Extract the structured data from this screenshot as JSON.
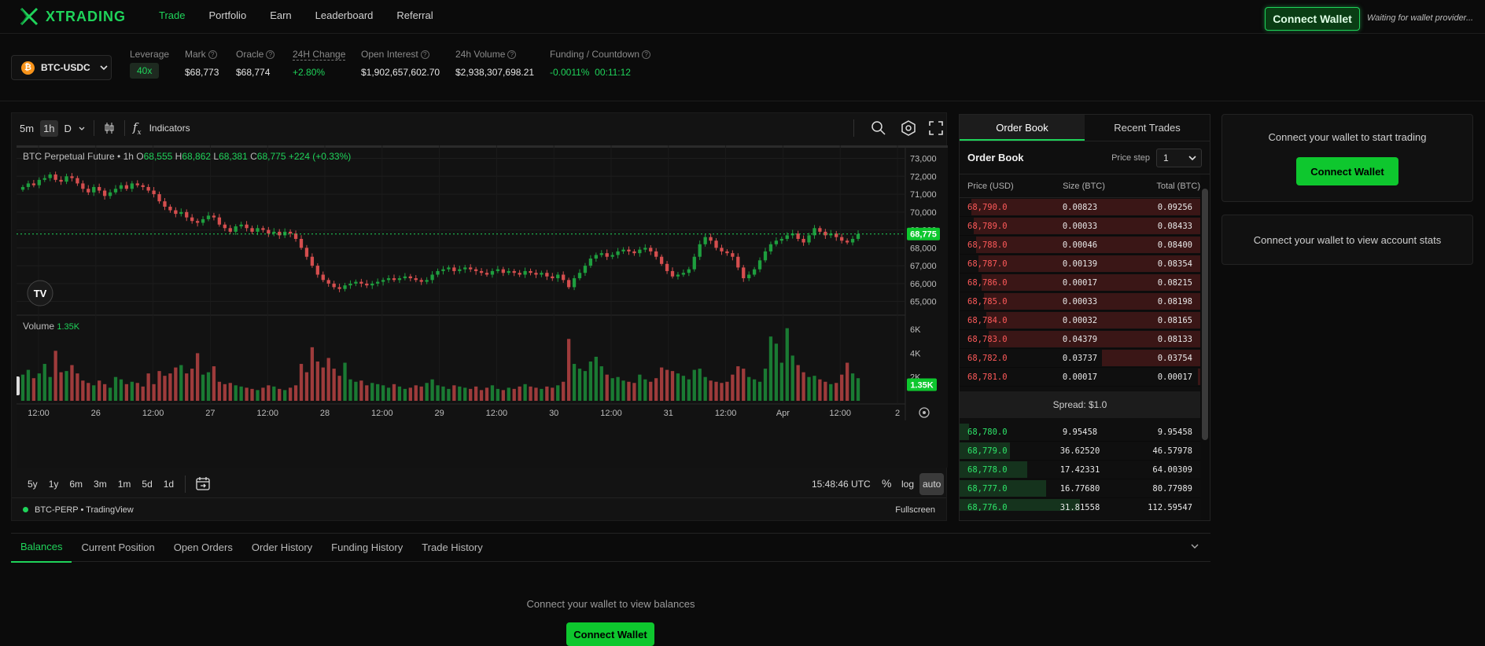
{
  "brand": {
    "name": "XTRADING",
    "color": "#1fd35a"
  },
  "nav": {
    "items": [
      "Trade",
      "Portfolio",
      "Earn",
      "Leaderboard",
      "Referral"
    ],
    "active": "Trade"
  },
  "header": {
    "connect_label": "Connect Wallet",
    "status": "Waiting for wallet provider..."
  },
  "market": {
    "symbol": "BTC-USDC",
    "stats": {
      "leverage_label": "Leverage",
      "leverage": "40x",
      "mark_label": "Mark",
      "mark": "$68,773",
      "oracle_label": "Oracle",
      "oracle": "$68,774",
      "change_label": "24H Change",
      "change": "+2.80%",
      "oi_label": "Open Interest",
      "oi": "$1,902,657,602.70",
      "vol_label": "24h Volume",
      "vol": "$2,938,307,698.21",
      "funding_label": "Funding / Countdown",
      "funding": "-0.0011%",
      "countdown": "00:11:12"
    }
  },
  "chart_toolbar": {
    "timeframes": [
      "5m",
      "1h",
      "D"
    ],
    "active_tf": "1h",
    "indicators": "Indicators"
  },
  "chart_data": {
    "type": "candlestick",
    "title": "BTC Perpetual Future",
    "interval": "1h",
    "ohlc": {
      "o": "68,555",
      "h": "68,862",
      "l": "68,381",
      "c": "68,775",
      "chg": "+224 (+0.33%)"
    },
    "last_price": "68,775",
    "y_ticks": [
      "73,000",
      "72,000",
      "71,000",
      "70,000",
      "69,000",
      "68,000",
      "67,000",
      "66,000",
      "65,000"
    ],
    "ylim": [
      64500,
      73200
    ],
    "x_ticks": [
      "12:00",
      "26",
      "12:00",
      "27",
      "12:00",
      "28",
      "12:00",
      "29",
      "12:00",
      "30",
      "12:00",
      "31",
      "12:00",
      "Apr",
      "12:00",
      "2"
    ],
    "volume_label": "Volume",
    "volume_value": "1.35K",
    "volume_ticks": [
      "6K",
      "4K",
      "2K"
    ],
    "volume_ylim": [
      0,
      6800
    ],
    "closes": [
      71400,
      71600,
      71500,
      71800,
      71900,
      72100,
      71800,
      71700,
      72000,
      71900,
      71600,
      71300,
      71100,
      71400,
      71200,
      70900,
      71100,
      71300,
      71500,
      71300,
      71600,
      71500,
      71400,
      71200,
      71000,
      70600,
      70300,
      70100,
      69900,
      70000,
      69700,
      69500,
      69400,
      69600,
      69800,
      69700,
      69300,
      69100,
      68900,
      69200,
      69300,
      69100,
      68900,
      69100,
      69000,
      68800,
      68900,
      68700,
      68900,
      68800,
      68500,
      68000,
      67500,
      67000,
      66500,
      66200,
      66000,
      65800,
      65700,
      65900,
      66000,
      66100,
      66000,
      65900,
      66000,
      66100,
      66200,
      66300,
      66200,
      66300,
      66400,
      66300,
      66200,
      66100,
      66200,
      66500,
      66700,
      66800,
      66900,
      66700,
      66800,
      66900,
      66800,
      66700,
      66600,
      66500,
      66700,
      66800,
      66600,
      66700,
      66600,
      66500,
      66700,
      66600,
      66500,
      66600,
      66400,
      66300,
      66500,
      66200,
      65800,
      66300,
      66600,
      67000,
      67400,
      67600,
      67700,
      67500,
      67600,
      67800,
      67900,
      67800,
      67700,
      67900,
      68000,
      67800,
      67500,
      67100,
      66700,
      66400,
      66500,
      66600,
      66800,
      67500,
      68200,
      68600,
      68400,
      68000,
      67800,
      67700,
      67500,
      66900,
      66300,
      66500,
      66800,
      67300,
      67800,
      68200,
      68400,
      68500,
      68700,
      68800,
      68500,
      68300,
      68700,
      69100,
      68900,
      68700,
      68800,
      68600,
      68400,
      68300,
      68500,
      68775
    ],
    "volumes": [
      2200,
      2600,
      1900,
      2300,
      3100,
      2000,
      4200,
      2400,
      2500,
      3000,
      2300,
      1700,
      1500,
      1300,
      1700,
      1400,
      1100,
      2000,
      1800,
      1400,
      1600,
      1500,
      1200,
      2300,
      1400,
      2500,
      2100,
      2300,
      2800,
      3000,
      2300,
      2700,
      4000,
      2200,
      2400,
      2900,
      1600,
      1400,
      1500,
      1300,
      1200,
      1100,
      1000,
      900,
      1100,
      1300,
      1200,
      1000,
      900,
      1100,
      1300,
      3100,
      2400,
      4500,
      3300,
      2800,
      3600,
      2700,
      2100,
      3200,
      1800,
      1600,
      1700,
      1300,
      1500,
      1400,
      1300,
      1100,
      1400,
      1200,
      1000,
      1100,
      1300,
      1200,
      1500,
      1800,
      1300,
      1200,
      1000,
      1300,
      1200,
      1100,
      1000,
      1200,
      900,
      1100,
      1300,
      1000,
      900,
      1100,
      1000,
      1200,
      1400,
      1200,
      1100,
      1000,
      1200,
      1100,
      1300,
      1600,
      5200,
      3100,
      2700,
      2500,
      3300,
      3700,
      2900,
      2200,
      1900,
      2000,
      1700,
      1600,
      1500,
      2200,
      1800,
      1600,
      1900,
      2800,
      2600,
      2500,
      2300,
      2100,
      1800,
      2600,
      2700,
      2000,
      1700,
      1600,
      1500,
      1600,
      2200,
      2900,
      2700,
      2000,
      1800,
      1600,
      2700,
      5400,
      4800,
      3200,
      6100,
      3800,
      3000,
      2400,
      2000,
      2100,
      1800,
      1600,
      1400,
      1500,
      2200,
      3200,
      2300,
      1900,
      1700,
      2100,
      1500,
      1400,
      3100,
      2200,
      1350
    ]
  },
  "chart_footer": {
    "ranges": [
      "5y",
      "1y",
      "6m",
      "3m",
      "1m",
      "5d",
      "1d"
    ],
    "time": "15:48:46 UTC",
    "pct": "%",
    "log": "log",
    "auto": "auto",
    "source": "BTC-PERP • TradingView",
    "fullscreen": "Fullscreen"
  },
  "orderbook": {
    "tabs": [
      "Order Book",
      "Recent Trades"
    ],
    "active_tab": "Order Book",
    "title": "Order Book",
    "price_step_label": "Price step",
    "price_step": "1",
    "columns": [
      "Price (USD)",
      "Size (BTC)",
      "Total (BTC)"
    ],
    "asks": [
      {
        "price": "68,790.0",
        "size": "0.00823",
        "total": "0.09256",
        "depth": 0.95
      },
      {
        "price": "68,789.0",
        "size": "0.00033",
        "total": "0.08433",
        "depth": 0.94
      },
      {
        "price": "68,788.0",
        "size": "0.00046",
        "total": "0.08400",
        "depth": 0.93
      },
      {
        "price": "68,787.0",
        "size": "0.00139",
        "total": "0.08354",
        "depth": 0.92
      },
      {
        "price": "68,786.0",
        "size": "0.00017",
        "total": "0.08215",
        "depth": 0.91
      },
      {
        "price": "68,785.0",
        "size": "0.00033",
        "total": "0.08198",
        "depth": 0.9
      },
      {
        "price": "68,784.0",
        "size": "0.00032",
        "total": "0.08165",
        "depth": 0.89
      },
      {
        "price": "68,783.0",
        "size": "0.04379",
        "total": "0.08133",
        "depth": 0.88
      },
      {
        "price": "68,782.0",
        "size": "0.03737",
        "total": "0.03754",
        "depth": 0.41
      },
      {
        "price": "68,781.0",
        "size": "0.00017",
        "total": "0.00017",
        "depth": 0.01
      }
    ],
    "spread": "Spread: $1.0",
    "bids": [
      {
        "price": "68,780.0",
        "size": "9.95458",
        "total": "9.95458",
        "depth": 0.04
      },
      {
        "price": "68,779.0",
        "size": "36.62520",
        "total": "46.57978",
        "depth": 0.21
      },
      {
        "price": "68,778.0",
        "size": "17.42331",
        "total": "64.00309",
        "depth": 0.28
      },
      {
        "price": "68,777.0",
        "size": "16.77680",
        "total": "80.77989",
        "depth": 0.36
      },
      {
        "price": "68,776.0",
        "size": "31.81558",
        "total": "112.59547",
        "depth": 0.5
      }
    ]
  },
  "side": {
    "trade_msg": "Connect your wallet to start trading",
    "trade_btn": "Connect Wallet",
    "stats_msg": "Connect your wallet to view account stats"
  },
  "bottom": {
    "tabs": [
      "Balances",
      "Current Position",
      "Open Orders",
      "Order History",
      "Funding History",
      "Trade History"
    ],
    "active": "Balances",
    "msg": "Connect your wallet to view balances",
    "btn": "Connect Wallet"
  }
}
